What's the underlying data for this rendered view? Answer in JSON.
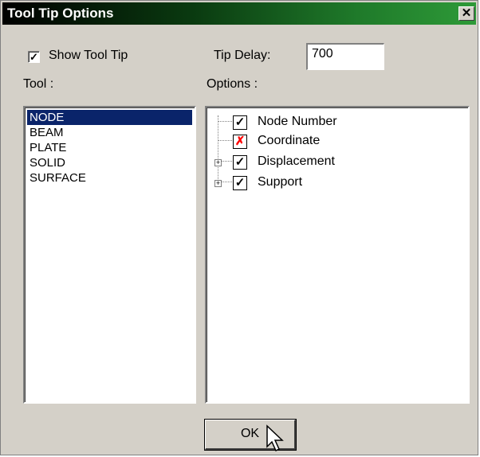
{
  "window": {
    "title": "Tool Tip Options",
    "close_label": "✕"
  },
  "show_tooltip": {
    "label": "Show Tool Tip",
    "checked": true
  },
  "tip_delay": {
    "label": "Tip Delay:",
    "value": "700"
  },
  "tool": {
    "label": "Tool :",
    "items": [
      "NODE",
      "BEAM",
      "PLATE",
      "SOLID",
      "SURFACE"
    ],
    "selected": "NODE"
  },
  "options": {
    "label": "Options :",
    "items": [
      {
        "label": "Node Number",
        "state": "checked",
        "expandable": false
      },
      {
        "label": "Coordinate",
        "state": "excluded",
        "expandable": false
      },
      {
        "label": "Displacement",
        "state": "checked",
        "expandable": true
      },
      {
        "label": "Support",
        "state": "checked",
        "expandable": true
      }
    ]
  },
  "buttons": {
    "ok": "OK"
  },
  "colors": {
    "selection": "#0a246a",
    "check": "#000000",
    "cross": "#ff0000"
  },
  "icons": {
    "check": "checkmark-icon",
    "cross": "x-mark-icon",
    "expand": "plus-box-icon"
  }
}
